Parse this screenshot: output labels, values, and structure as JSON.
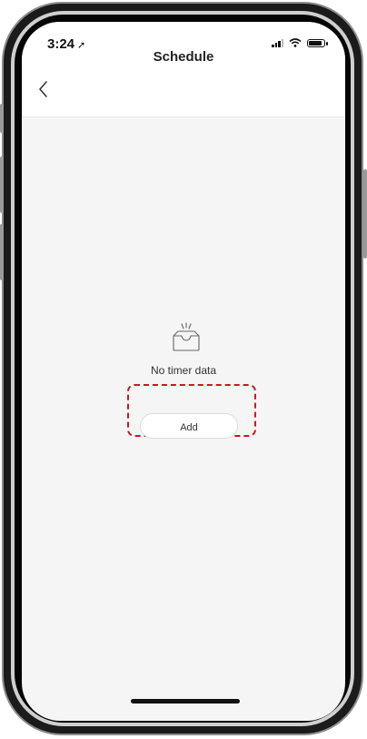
{
  "status_bar": {
    "time": "3:24",
    "location_glyph": "➚",
    "icons": [
      "signal-icon",
      "wifi-icon",
      "battery-icon"
    ]
  },
  "nav": {
    "title": "Schedule",
    "back_icon": "chevron-left-icon"
  },
  "empty_state": {
    "icon": "empty-inbox-icon",
    "message": "No timer data",
    "add_label": "Add"
  },
  "colors": {
    "highlight": "#d0141d",
    "screen_bg": "#f5f5f5"
  }
}
